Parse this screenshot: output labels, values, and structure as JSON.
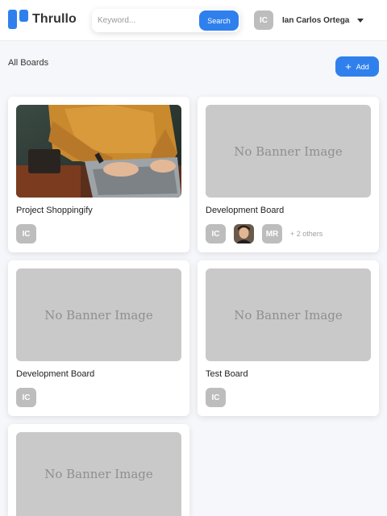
{
  "header": {
    "logo_text": "Thrullo",
    "search": {
      "placeholder": "Keyword...",
      "button_label": "Search"
    },
    "user": {
      "initials": "IC",
      "name": "Ian Carlos Ortega"
    }
  },
  "section": {
    "title": "All Boards",
    "add_label": "Add"
  },
  "colors": {
    "primary": "#2f80ed",
    "avatar_gray": "#bdbdbd",
    "banner_gray": "#c9c9c9"
  },
  "no_banner_text": "No Banner Image",
  "boards": [
    {
      "title": "Project Shoppingify",
      "banner": "photo",
      "members": [
        "IC"
      ],
      "others": ""
    },
    {
      "title": "Development Board",
      "banner": "none",
      "members": [
        "IC",
        "photo",
        "MR"
      ],
      "others": "+ 2 others"
    },
    {
      "title": "Development Board",
      "banner": "none",
      "members": [
        "IC"
      ],
      "others": ""
    },
    {
      "title": "Test Board",
      "banner": "none",
      "members": [
        "IC"
      ],
      "others": ""
    },
    {
      "title": "",
      "banner": "none",
      "members": [],
      "others": ""
    }
  ]
}
